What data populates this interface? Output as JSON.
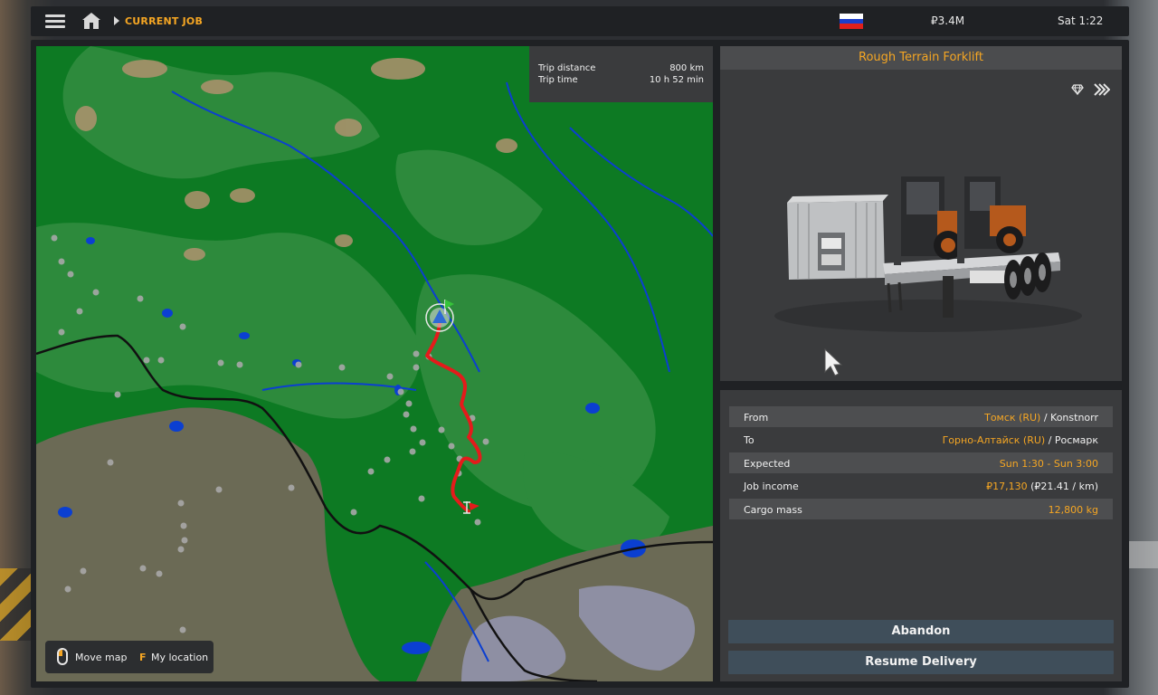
{
  "topbar": {
    "breadcrumb": "CURRENT JOB",
    "money": "₽3.4M",
    "time": "Sat 1:22",
    "flag_colors": [
      "#ffffff",
      "#1c3ecb",
      "#e0201b"
    ]
  },
  "map": {
    "trip": {
      "distance_label": "Trip distance",
      "distance_value": "800 km",
      "time_label": "Trip time",
      "time_value": "10 h 52 min"
    },
    "help": {
      "move_label": "Move map",
      "location_key": "F",
      "location_label": "My location"
    },
    "colors": {
      "forest": "#0d7a23",
      "lowland": "#2d8a3c",
      "steppe": "#6b6a55",
      "water": "#0b3fd1",
      "route": "#e41b1b",
      "border": "#111111"
    }
  },
  "cargo": {
    "title": "Rough Terrain Forklift"
  },
  "job": {
    "from": {
      "label": "From",
      "city": "Томск (RU)",
      "sep": " / ",
      "company": "Konstnorr"
    },
    "to": {
      "label": "To",
      "city": "Горно-Алтайск (RU)",
      "sep": " / ",
      "company": "Росмарк"
    },
    "expected": {
      "label": "Expected",
      "value": "Sun 1:30 - Sun 3:00"
    },
    "income": {
      "label": "Job income",
      "value": "₽17,130",
      "rate": " (₽21.41 / km)"
    },
    "mass": {
      "label": "Cargo mass",
      "value": "12,800 kg"
    }
  },
  "actions": {
    "abandon": "Abandon",
    "resume": "Resume Delivery"
  },
  "icons": [
    "menu-icon",
    "home-icon",
    "breadcrumb-arrow-icon",
    "russia-flag-icon",
    "mouse-icon",
    "gem-icon",
    "fast-forward-icon",
    "cursor-icon"
  ]
}
